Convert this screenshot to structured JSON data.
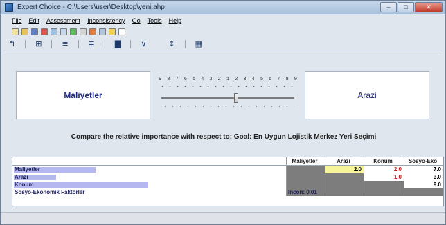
{
  "window": {
    "title": "Expert Choice - C:\\Users\\user\\Desktop\\yeni.ahp",
    "controls": [
      "–",
      "□",
      "✕"
    ]
  },
  "menu": [
    "File",
    "Edit",
    "Assessment",
    "Inconsistency",
    "Go",
    "Tools",
    "Help"
  ],
  "comparison": {
    "left_label": "Maliyetler",
    "right_label": "Arazi",
    "scale_numbers": [
      "9",
      "8",
      "7",
      "6",
      "5",
      "4",
      "3",
      "2",
      "1",
      "2",
      "3",
      "4",
      "5",
      "6",
      "7",
      "8",
      "9"
    ],
    "thumb_value": "2",
    "prompt": "Compare the relative importance with respect to: Goal: En Uygun Lojistik Merkez Yeri Seçimi"
  },
  "matrix": {
    "columns": [
      "Maliyetler",
      "Arazi",
      "Konum",
      "Sosyo-Eko"
    ],
    "rows": [
      {
        "label": "Maliyetler",
        "bar": 0.31,
        "cells": [
          "",
          "2.0",
          "2.0",
          "7.0"
        ]
      },
      {
        "label": "Arazi",
        "bar": 0.16,
        "cells": [
          "",
          "",
          "1.0",
          "3.0"
        ]
      },
      {
        "label": "Konum",
        "bar": 0.51,
        "cells": [
          "",
          "",
          "",
          "9.0"
        ]
      },
      {
        "label": "Sosyo-Ekonomik Faktörler",
        "bar": 0.0,
        "cells": [
          "",
          "",
          "",
          ""
        ]
      }
    ],
    "inconsistency": "Incon: 0.01"
  },
  "colors": {
    "bar": "#b5b8f0",
    "highlight": "#f7f59a",
    "inverse": "#c41a1a",
    "label": "#1f2a7a"
  }
}
